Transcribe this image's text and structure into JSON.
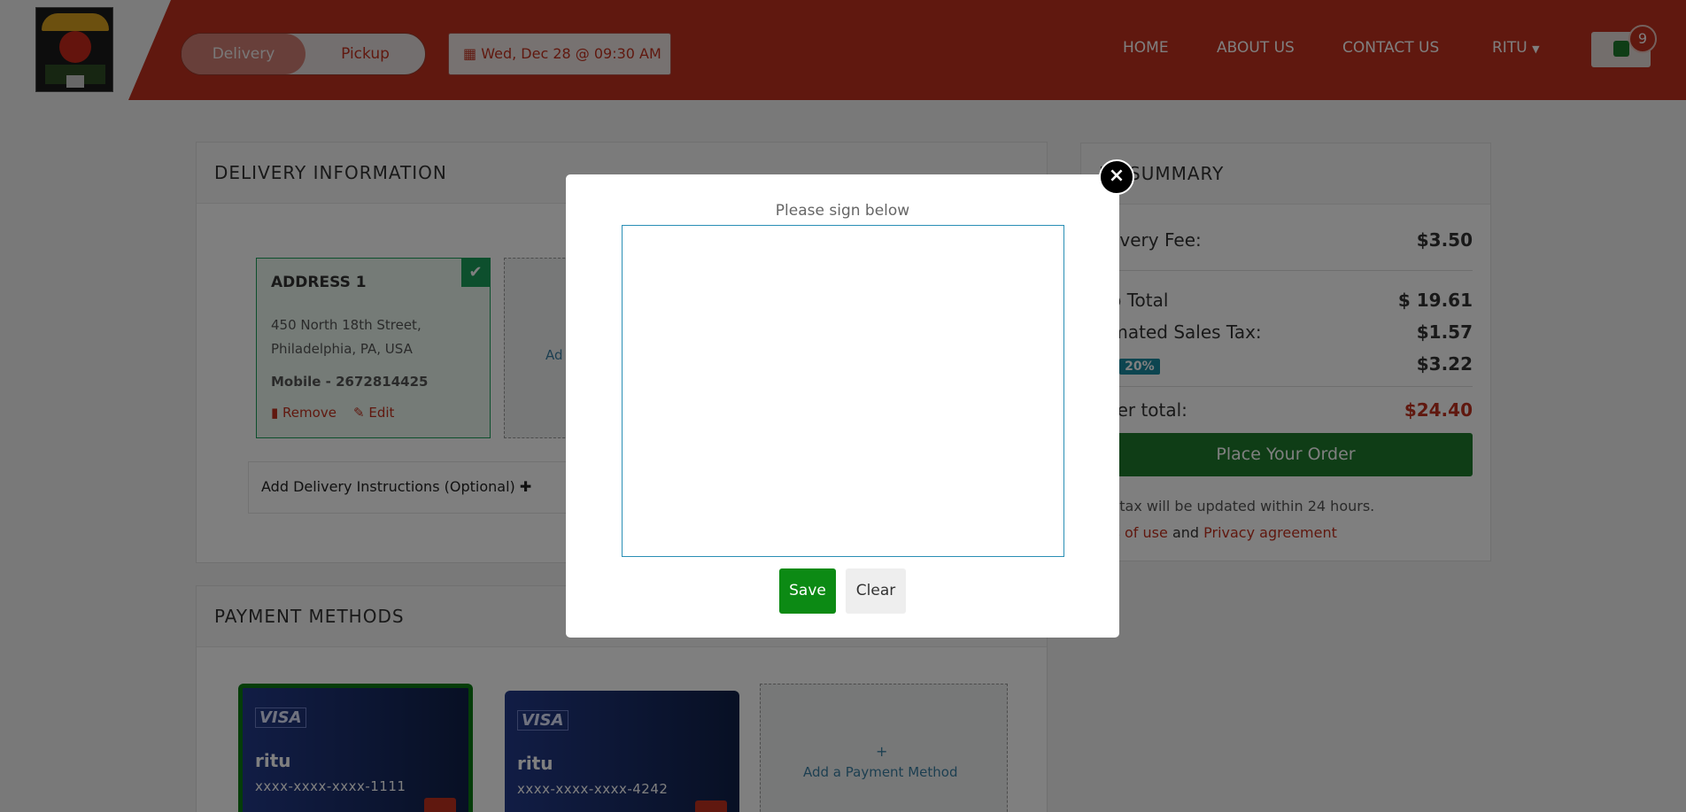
{
  "header": {
    "delivery_label": "Delivery",
    "pickup_label": "Pickup",
    "datetime": "Wed, Dec 28 @ 09:30 AM",
    "nav": [
      "HOME",
      "ABOUT US",
      "CONTACT US"
    ],
    "user": "RITU",
    "cart_count": "9",
    "accent_color": "#c0311e"
  },
  "delivery": {
    "title": "DELIVERY INFORMATION",
    "address": {
      "title": "ADDRESS 1",
      "line1": "450 North 18th Street,",
      "line2": "Philadelphia, PA, USA",
      "mobile": "Mobile - 2672814425",
      "remove_label": "Remove",
      "edit_label": "Edit"
    },
    "add_address_partial": "Ad",
    "instructions_label": "Add Delivery Instructions (Optional) ✚"
  },
  "payment": {
    "title": "PAYMENT METHODS",
    "cards": [
      {
        "brand": "VISA",
        "name": "ritu",
        "number": "xxxx-xxxx-xxxx-1111"
      },
      {
        "brand": "VISA",
        "name": "ritu",
        "number": "xxxx-xxxx-xxxx-4242"
      }
    ],
    "add_plus": "+",
    "add_label": "Add a Payment Method"
  },
  "summary": {
    "title": "RT SUMMARY",
    "delivery_fee_label": "elivery Fee:",
    "delivery_fee": "$3.50",
    "subtotal_label": "ub Total",
    "subtotal": "$ 19.61",
    "tax_label": "timated Sales Tax:",
    "tax": "$1.57",
    "tips_label": "s:",
    "tips_badge": "20%",
    "tips": "$3.22",
    "total_label": "rder total:",
    "total": "$24.40",
    "place_order": "Place Your Order",
    "note": "es tax will be updated within 24 hours.",
    "terms_link": "ms of use",
    "and_text": "and",
    "privacy_link": "Privacy agreement"
  },
  "modal": {
    "close_glyph": "×",
    "label": "Please sign below",
    "save_label": "Save",
    "clear_label": "Clear"
  }
}
